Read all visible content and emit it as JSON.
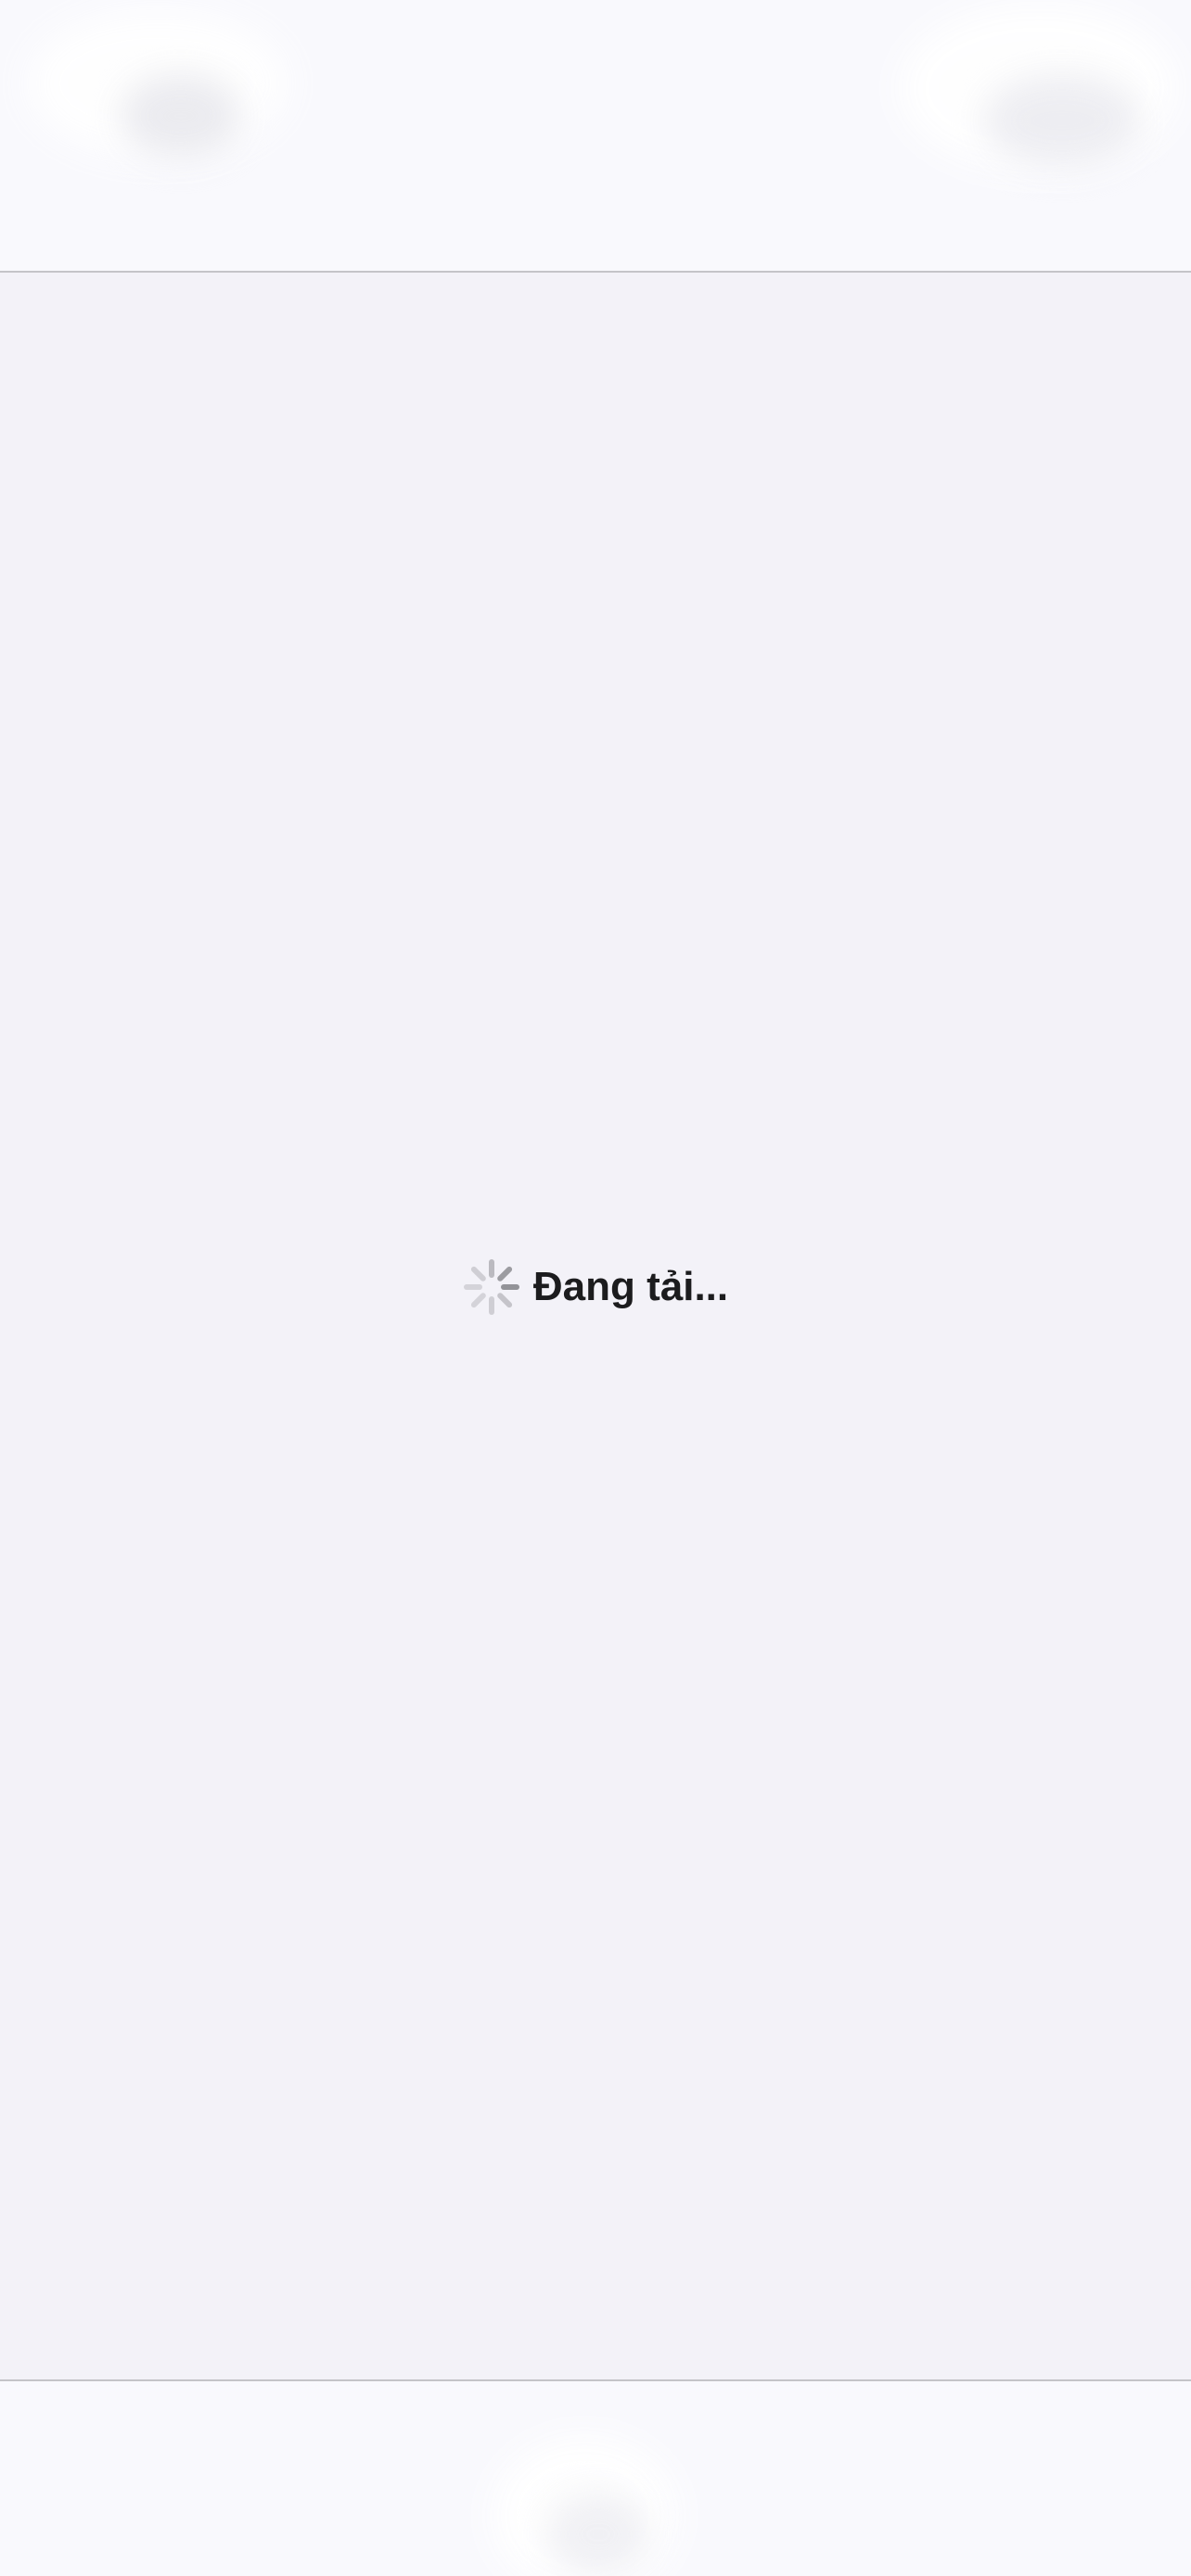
{
  "loading": {
    "label": "Đang tải...",
    "spinner_icon": "activity-indicator-icon"
  },
  "colors": {
    "background": "#f3f2f8",
    "bar_background": "#f9f9fd",
    "separator": "#c4c4c8",
    "text": "#1c1c1e",
    "spinner": "#8e8e93"
  }
}
